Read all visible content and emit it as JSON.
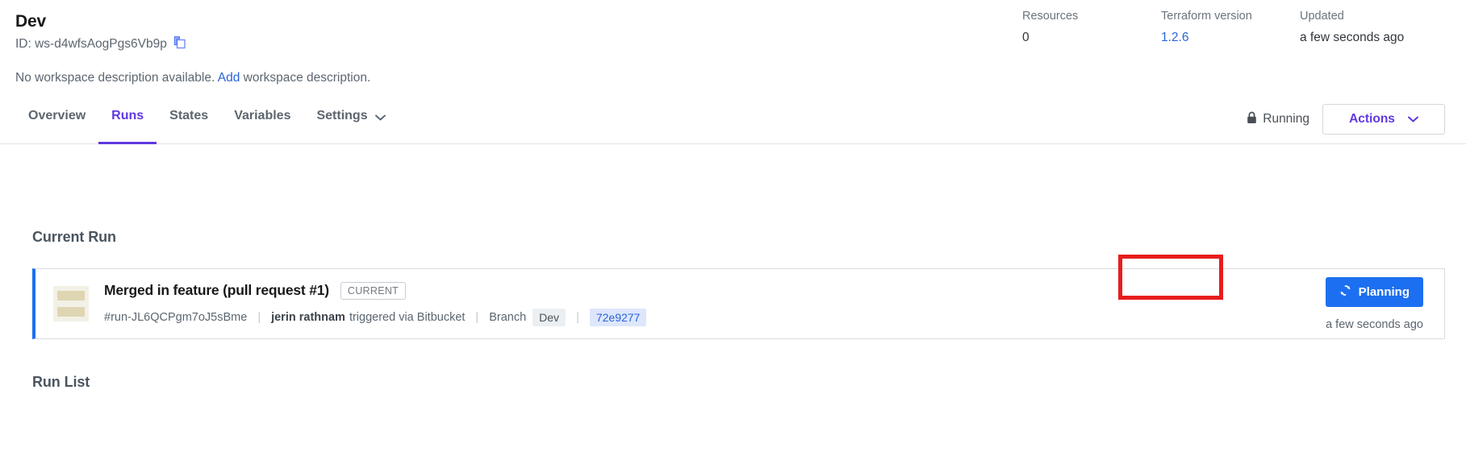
{
  "workspace": {
    "name": "Dev",
    "id_label": "ID: ws-d4wfsAogPgs6Vb9p",
    "copy_icon": "copy-icon",
    "description_text": "No workspace description available.",
    "description_link": "Add",
    "description_suffix": "workspace description."
  },
  "meta": {
    "resources_label": "Resources",
    "resources_value": "0",
    "terraform_label": "Terraform version",
    "terraform_value": "1.2.6",
    "updated_label": "Updated",
    "updated_value": "a few seconds ago"
  },
  "tabs": [
    {
      "label": "Overview",
      "active": false
    },
    {
      "label": "Runs",
      "active": true
    },
    {
      "label": "States",
      "active": false
    },
    {
      "label": "Variables",
      "active": false
    },
    {
      "label": "Settings",
      "active": false,
      "has_chevron": true
    }
  ],
  "status": {
    "lock_icon": "lock-icon",
    "label": "Running"
  },
  "actions": {
    "label": "Actions",
    "chevron_icon": "chevron-down-icon"
  },
  "current_run": {
    "section_title": "Current Run",
    "title": "Merged in feature (pull request #1)",
    "badge": "CURRENT",
    "run_id": "#run-JL6QCPgm7oJ5sBme",
    "user": "jerin rathnam",
    "trigger_text": "triggered via Bitbucket",
    "branch_label": "Branch",
    "branch_name": "Dev",
    "commit": "72e9277",
    "separator": "|",
    "status_button": {
      "label": "Planning",
      "icon": "spinner-icon",
      "color": "#1c6ff0"
    },
    "time": "a few seconds ago"
  },
  "run_list": {
    "section_title": "Run List"
  },
  "colors": {
    "accent_purple": "#6038e0",
    "link_blue": "#2b64d9",
    "planning_blue": "#1c6ff0",
    "annotation_red": "#e81c1c",
    "card_border_blue": "#1c6ff0"
  }
}
